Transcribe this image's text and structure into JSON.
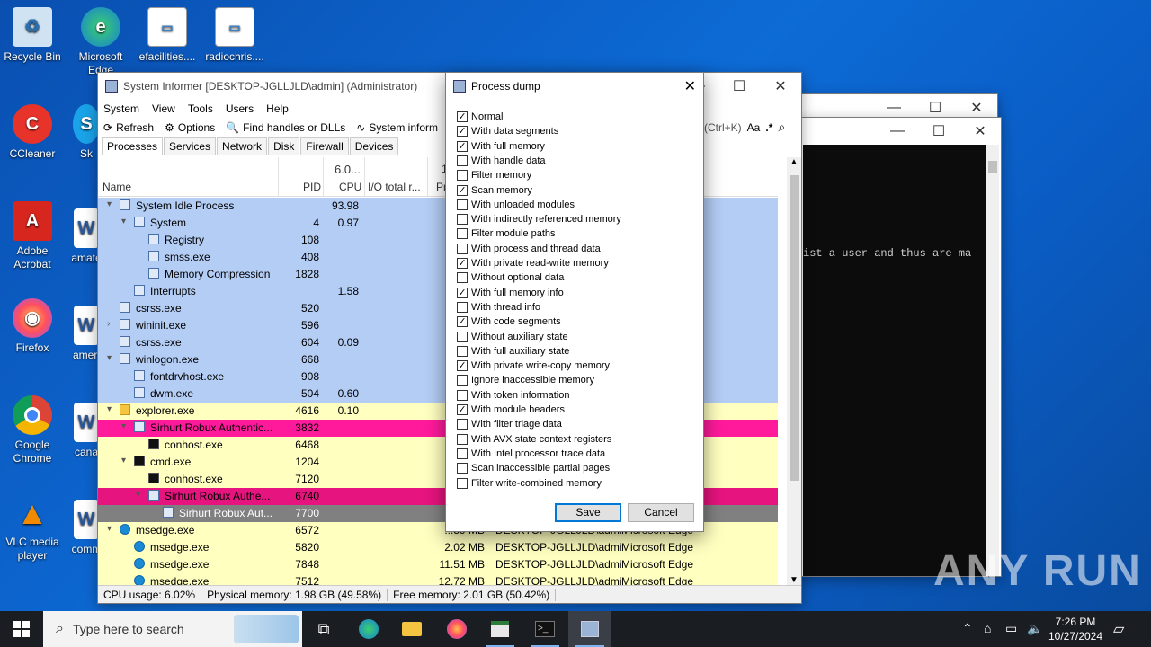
{
  "desktop": {
    "icons": [
      {
        "label": "Recycle Bin"
      },
      {
        "label": "Microsoft Edge"
      },
      {
        "label": "efacilities...."
      },
      {
        "label": "radiochris...."
      },
      {
        "label": "CCleaner"
      },
      {
        "label": "Sk"
      },
      {
        "label": "Adobe Acrobat"
      },
      {
        "label": "amate"
      },
      {
        "label": "Firefox"
      },
      {
        "label": "ameri"
      },
      {
        "label": "Google Chrome"
      },
      {
        "label": "cana"
      },
      {
        "label": "VLC media player"
      },
      {
        "label": "comm"
      }
    ]
  },
  "sysinformer": {
    "title": "System Informer [DESKTOP-JGLLJLD\\admin] (Administrator)",
    "menu": [
      "System",
      "View",
      "Tools",
      "Users",
      "Help"
    ],
    "toolbar": {
      "refresh": "Refresh",
      "options": "Options",
      "find": "Find handles or DLLs",
      "sysinfo": "System inform"
    },
    "search_hint": "(Ctrl+K)",
    "search_aa": "Aa",
    "search_star": ".*",
    "tabs": [
      "Processes",
      "Services",
      "Network",
      "Disk",
      "Firewall",
      "Devices"
    ],
    "columns": {
      "name": "Name",
      "pid": "PID",
      "cpu_total": "6.0...",
      "cpu": "CPU",
      "io": "I/O total r...",
      "pr_top": "1",
      "pr": "Pr"
    },
    "rows": [
      {
        "name": "System Idle Process",
        "pid": "",
        "cpu": "93.98",
        "io": "",
        "user": "",
        "desc": ""
      },
      {
        "name": "System",
        "pid": "4",
        "cpu": "0.97",
        "io": "",
        "user": "",
        "desc": "m"
      },
      {
        "name": "Registry",
        "pid": "108",
        "cpu": "",
        "io": "",
        "user": "",
        "desc": ""
      },
      {
        "name": "smss.exe",
        "pid": "408",
        "cpu": "",
        "io": "",
        "user": "",
        "desc": "Manager"
      },
      {
        "name": "Memory Compression",
        "pid": "1828",
        "cpu": "",
        "io": "",
        "user": "",
        "desc": ""
      },
      {
        "name": "Interrupts",
        "pid": "",
        "cpu": "1.58",
        "io": "",
        "user": "",
        "desc": "Cs"
      },
      {
        "name": "csrss.exe",
        "pid": "520",
        "cpu": "",
        "io": "",
        "user": "",
        "desc": "ime Process"
      },
      {
        "name": "wininit.exe",
        "pid": "596",
        "cpu": "",
        "io": "",
        "user": "",
        "desc": "Application"
      },
      {
        "name": "csrss.exe",
        "pid": "604",
        "cpu": "0.09",
        "io": "",
        "user": "",
        "desc": "ime Process"
      },
      {
        "name": "winlogon.exe",
        "pid": "668",
        "cpu": "",
        "io": "",
        "user": "",
        "desc": "Application"
      },
      {
        "name": "fontdrvhost.exe",
        "pid": "908",
        "cpu": "",
        "io": "",
        "user": "",
        "desc": "river Host"
      },
      {
        "name": "dwm.exe",
        "pid": "504",
        "cpu": "0.60",
        "io": "4",
        "user": "",
        "desc": "Manager"
      },
      {
        "name": "explorer.exe",
        "pid": "4616",
        "cpu": "0.10",
        "io": "",
        "user": "",
        "desc": "r"
      },
      {
        "name": "Sirhurt Robux Authentic...",
        "pid": "3832",
        "cpu": "",
        "io": "2",
        "user": "",
        "desc": ""
      },
      {
        "name": "conhost.exe",
        "pid": "6468",
        "cpu": "",
        "io": "",
        "user": "",
        "desc": "Host"
      },
      {
        "name": "cmd.exe",
        "pid": "1204",
        "cpu": "",
        "io": "",
        "user": "",
        "desc": "nd Processor"
      },
      {
        "name": "conhost.exe",
        "pid": "7120",
        "cpu": "",
        "io": "",
        "user": "",
        "desc": "Host"
      },
      {
        "name": "Sirhurt Robux Authe...",
        "pid": "6740",
        "cpu": "",
        "io": "2",
        "user": "",
        "desc": ""
      },
      {
        "name": "Sirhurt Robux Aut...",
        "pid": "7700",
        "cpu": "",
        "io": "",
        "user": "",
        "desc": ""
      },
      {
        "name": "msedge.exe",
        "pid": "6572",
        "cpu": "",
        "io": "...59 MB",
        "user": "DESKTOP-JGLLJLD\\admi",
        "desc": "Microsoft Edge"
      },
      {
        "name": "msedge.exe",
        "pid": "5820",
        "cpu": "",
        "io": "2.02 MB",
        "user": "DESKTOP-JGLLJLD\\admi",
        "desc": "Microsoft Edge"
      },
      {
        "name": "msedge.exe",
        "pid": "7848",
        "cpu": "",
        "io": "11.51 MB",
        "user": "DESKTOP-JGLLJLD\\admi",
        "desc": "Microsoft Edge"
      },
      {
        "name": "msedge.exe",
        "pid": "7512",
        "cpu": "",
        "io": "12.72 MB",
        "user": "DESKTOP-JGLLJLD\\admi",
        "desc": "Microsoft Edge"
      }
    ],
    "status": {
      "cpu": "CPU usage: 6.02%",
      "phys": "Physical memory: 1.98 GB (49.58%)",
      "free": "Free memory: 2.01 GB (50.42%)"
    }
  },
  "dialog": {
    "title": "Process dump",
    "options": [
      {
        "label": "Normal",
        "checked": true
      },
      {
        "label": "With data segments",
        "checked": true
      },
      {
        "label": "With full memory",
        "checked": true
      },
      {
        "label": "With handle data",
        "checked": false
      },
      {
        "label": "Filter memory",
        "checked": false
      },
      {
        "label": "Scan memory",
        "checked": true
      },
      {
        "label": "With unloaded modules",
        "checked": false
      },
      {
        "label": "With indirectly referenced memory",
        "checked": false
      },
      {
        "label": "Filter module paths",
        "checked": false
      },
      {
        "label": "With process and thread data",
        "checked": false
      },
      {
        "label": "With private read-write memory",
        "checked": true
      },
      {
        "label": "Without optional data",
        "checked": false
      },
      {
        "label": "With full memory info",
        "checked": true
      },
      {
        "label": "With thread info",
        "checked": false
      },
      {
        "label": "With code segments",
        "checked": true
      },
      {
        "label": "Without auxiliary state",
        "checked": false
      },
      {
        "label": "With full auxiliary state",
        "checked": false
      },
      {
        "label": "With private write-copy memory",
        "checked": true
      },
      {
        "label": "Ignore inaccessible memory",
        "checked": false
      },
      {
        "label": "With token information",
        "checked": false
      },
      {
        "label": "With module headers",
        "checked": true
      },
      {
        "label": "With filter triage data",
        "checked": false
      },
      {
        "label": "With AVX state context registers",
        "checked": false
      },
      {
        "label": "With Intel processor trace data",
        "checked": false
      },
      {
        "label": "Scan inaccessible partial pages",
        "checked": false
      },
      {
        "label": "Filter write-combined memory",
        "checked": false
      }
    ],
    "save": "Save",
    "cancel": "Cancel"
  },
  "console": {
    "text": "ist a user and thus are ma"
  },
  "watermark": "ANY RUN",
  "taskbar": {
    "search_placeholder": "Type here to search",
    "time": "7:26 PM",
    "date": "10/27/2024"
  },
  "colors": {
    "blue_row": "#b4cdf5",
    "yellow_row": "#ffffc0",
    "pink_row": "#ff1a9c",
    "pink_row2": "#e6147e",
    "gray_row": "#808080",
    "accent": "#0078d7"
  }
}
